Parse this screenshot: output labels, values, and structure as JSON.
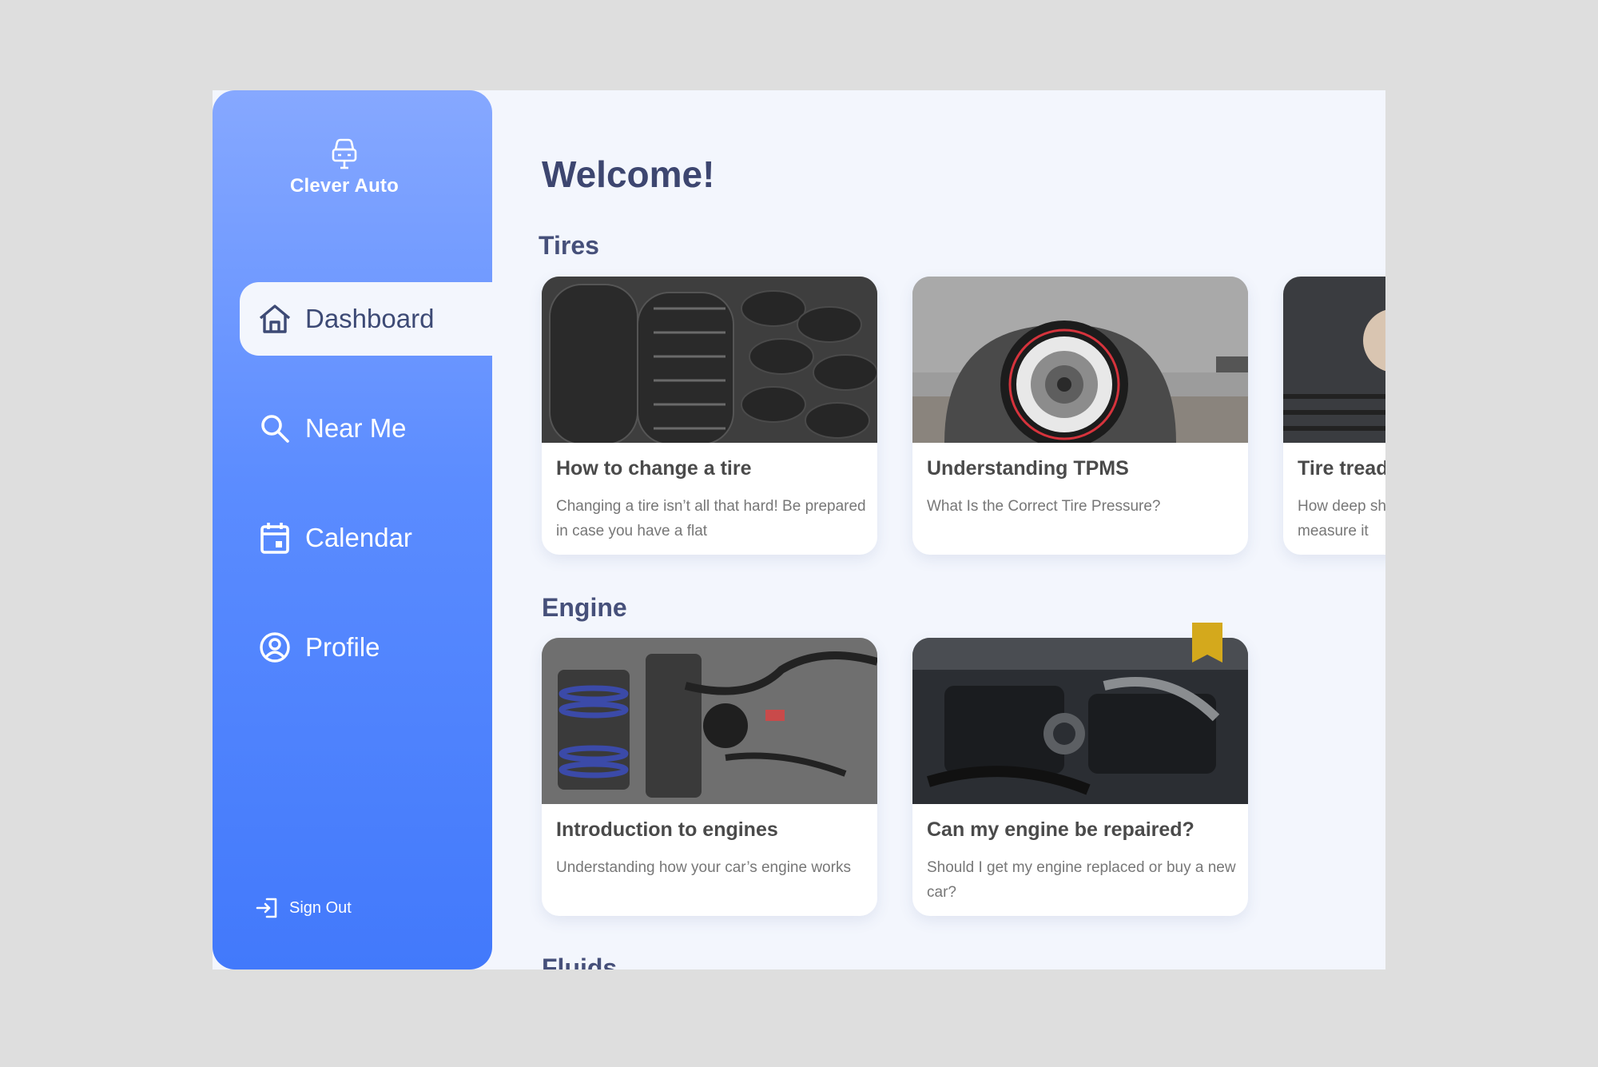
{
  "brand": {
    "name": "Clever Auto",
    "icon": "car-icon"
  },
  "nav": [
    {
      "label": "Dashboard",
      "icon": "home-icon",
      "active": true
    },
    {
      "label": "Near Me",
      "icon": "search-icon",
      "active": false
    },
    {
      "label": "Calendar",
      "icon": "calendar-icon",
      "active": false
    },
    {
      "label": "Profile",
      "icon": "user-circle-icon",
      "active": false
    }
  ],
  "signout": {
    "label": "Sign Out",
    "icon": "sign-out-icon"
  },
  "main": {
    "welcome": "Welcome!",
    "sections": [
      {
        "title": "Tires",
        "cards": [
          {
            "title": "How to change a tire",
            "description": "Changing a tire isn’t all that hard! Be prepared in case you have a flat",
            "image": "stacked-tires-photo"
          },
          {
            "title": "Understanding TPMS",
            "description": "What Is the Correct Tire Pressure?",
            "image": "car-wheel-photo"
          },
          {
            "title": "Tire tread",
            "description": "How deep should your tread be and how to measure it",
            "image": "tire-tread-photo"
          }
        ]
      },
      {
        "title": "Engine",
        "cards": [
          {
            "title": "Introduction to engines",
            "description": "Understanding how your car’s engine works",
            "image": "engine-parts-photo"
          },
          {
            "title": "Can my engine be repaired?",
            "description": "Should I get my engine replaced or buy a new car?",
            "image": "engine-bay-photo",
            "bookmarked": true
          }
        ]
      },
      {
        "title": "Fluids"
      }
    ]
  },
  "colors": {
    "sidebar_top": "#86a8ff",
    "sidebar_bottom": "#4279fb",
    "background": "#f3f6fd",
    "heading": "#3d4670",
    "bookmark": "#d4a91c"
  }
}
